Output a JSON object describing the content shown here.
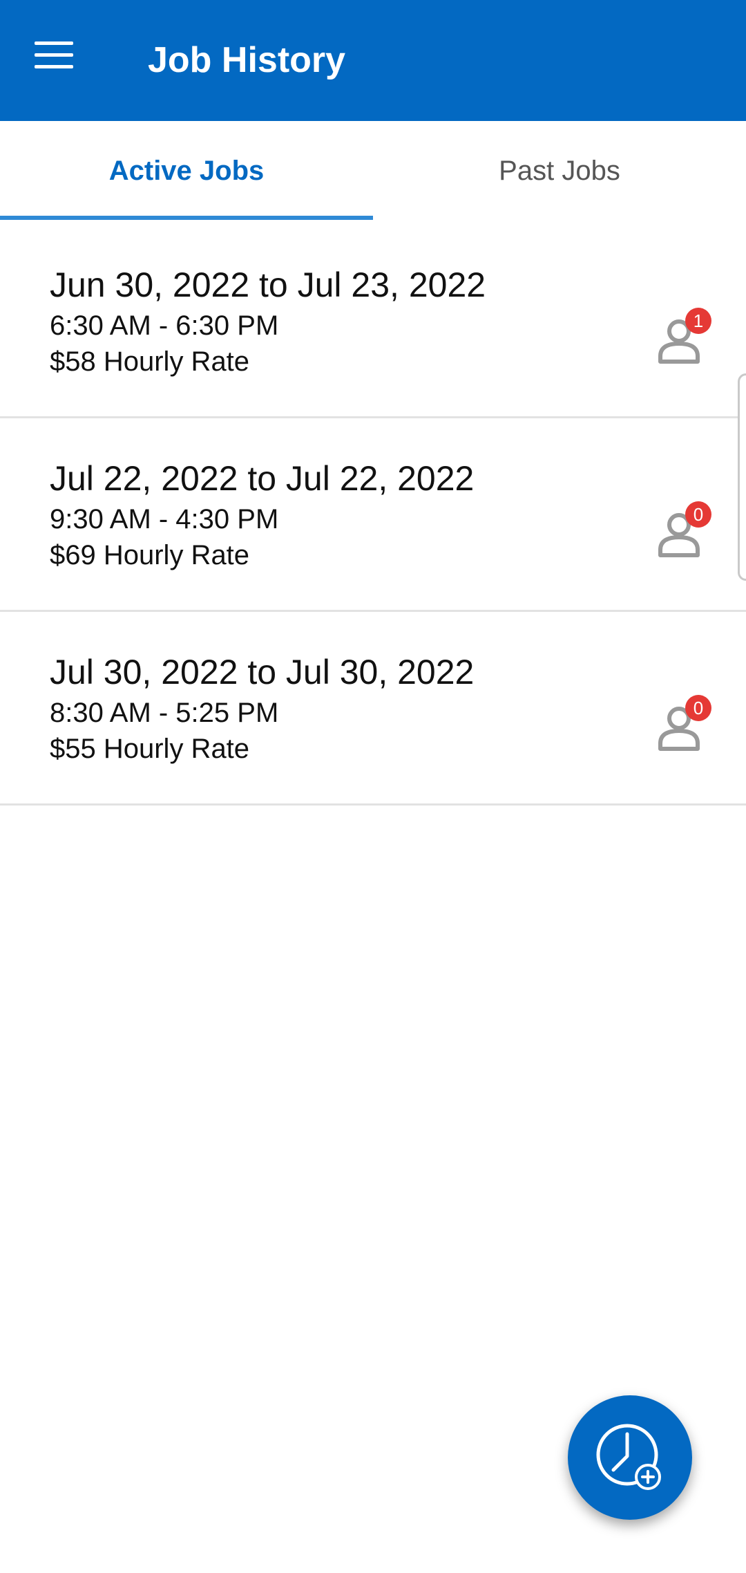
{
  "header": {
    "title": "Job History",
    "menu_icon": "hamburger-menu-icon",
    "background_color": "#0369c2"
  },
  "tabs": [
    {
      "label": "Active Jobs",
      "selected": true
    },
    {
      "label": "Past Jobs",
      "selected": false
    }
  ],
  "jobs": [
    {
      "dates": "Jun 30, 2022 to Jul 23, 2022",
      "time": "6:30 AM - 6:30 PM",
      "rate": "$58 Hourly Rate",
      "applicant_count": "1"
    },
    {
      "dates": "Jul 22, 2022 to Jul 22, 2022",
      "time": "9:30 AM - 4:30 PM",
      "rate": "$69 Hourly Rate",
      "applicant_count": "0"
    },
    {
      "dates": "Jul 30, 2022 to Jul 30, 2022",
      "time": "8:30 AM - 5:25 PM",
      "rate": "$55 Hourly Rate",
      "applicant_count": "0"
    }
  ],
  "fab": {
    "icon": "clock-add-icon"
  },
  "colors": {
    "accent": "#0369c2",
    "badge": "#e53935",
    "icon_gray": "#999999"
  }
}
